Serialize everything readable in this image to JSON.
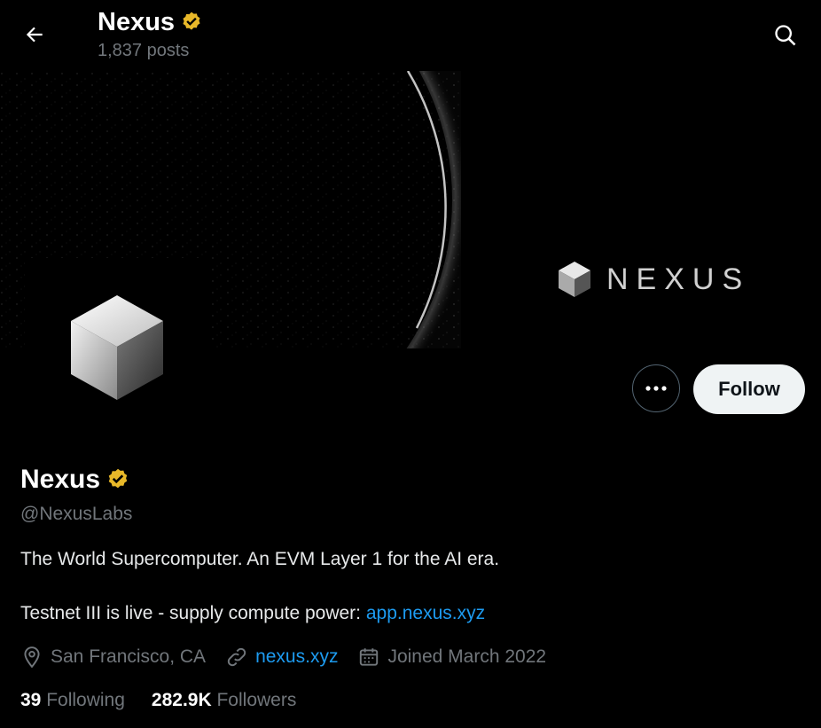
{
  "header": {
    "title": "Nexus",
    "posts_count": "1,837 posts",
    "back_icon": "arrow-left-icon",
    "search_icon": "search-icon"
  },
  "banner": {
    "brand_text": "NEXUS"
  },
  "actions": {
    "more_icon": "more-horizontal-icon",
    "follow_label": "Follow"
  },
  "profile": {
    "name": "Nexus",
    "handle": "@NexusLabs",
    "bio_line1": "The World Supercomputer. An EVM Layer 1 for the AI era.",
    "bio_line2_text": "Testnet III is live - supply compute power: ",
    "bio_line2_link": "app.nexus.xyz",
    "location": "San Francisco, CA",
    "website": "nexus.xyz",
    "joined": "Joined March 2022",
    "following_count": "39",
    "following_label": "Following",
    "followers_count": "282.9K",
    "followers_label": "Followers"
  },
  "colors": {
    "verified_badge": "#e8b829",
    "link": "#1d9bf0",
    "muted": "#71767b"
  }
}
